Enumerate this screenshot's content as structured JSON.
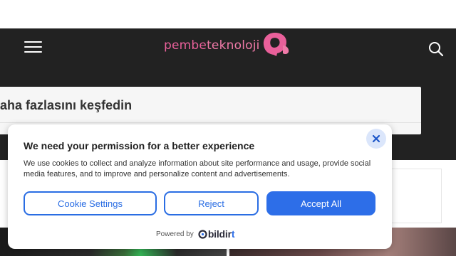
{
  "header": {
    "logo_part1": "pembe",
    "logo_part2": "teknoloji",
    "menu_icon": "hamburger-menu-icon",
    "search_icon": "search-icon"
  },
  "discover": {
    "text": "aha fazlasını keşfedin"
  },
  "consent": {
    "title": "We need your permission for a better experience",
    "body": "We use cookies to collect and analyze information about site performance and usage, provide social media features, and to improve and personalize content and advertisements.",
    "buttons": {
      "settings": "Cookie Settings",
      "reject": "Reject",
      "accept": "Accept All"
    },
    "powered_by": "Powered by",
    "brand": "bildir",
    "brand_suffix": "t",
    "close_icon": "close-icon"
  },
  "colors": {
    "header_bg": "#222222",
    "brand_pink": "#e9609a",
    "accent_blue": "#2d6ee8"
  }
}
